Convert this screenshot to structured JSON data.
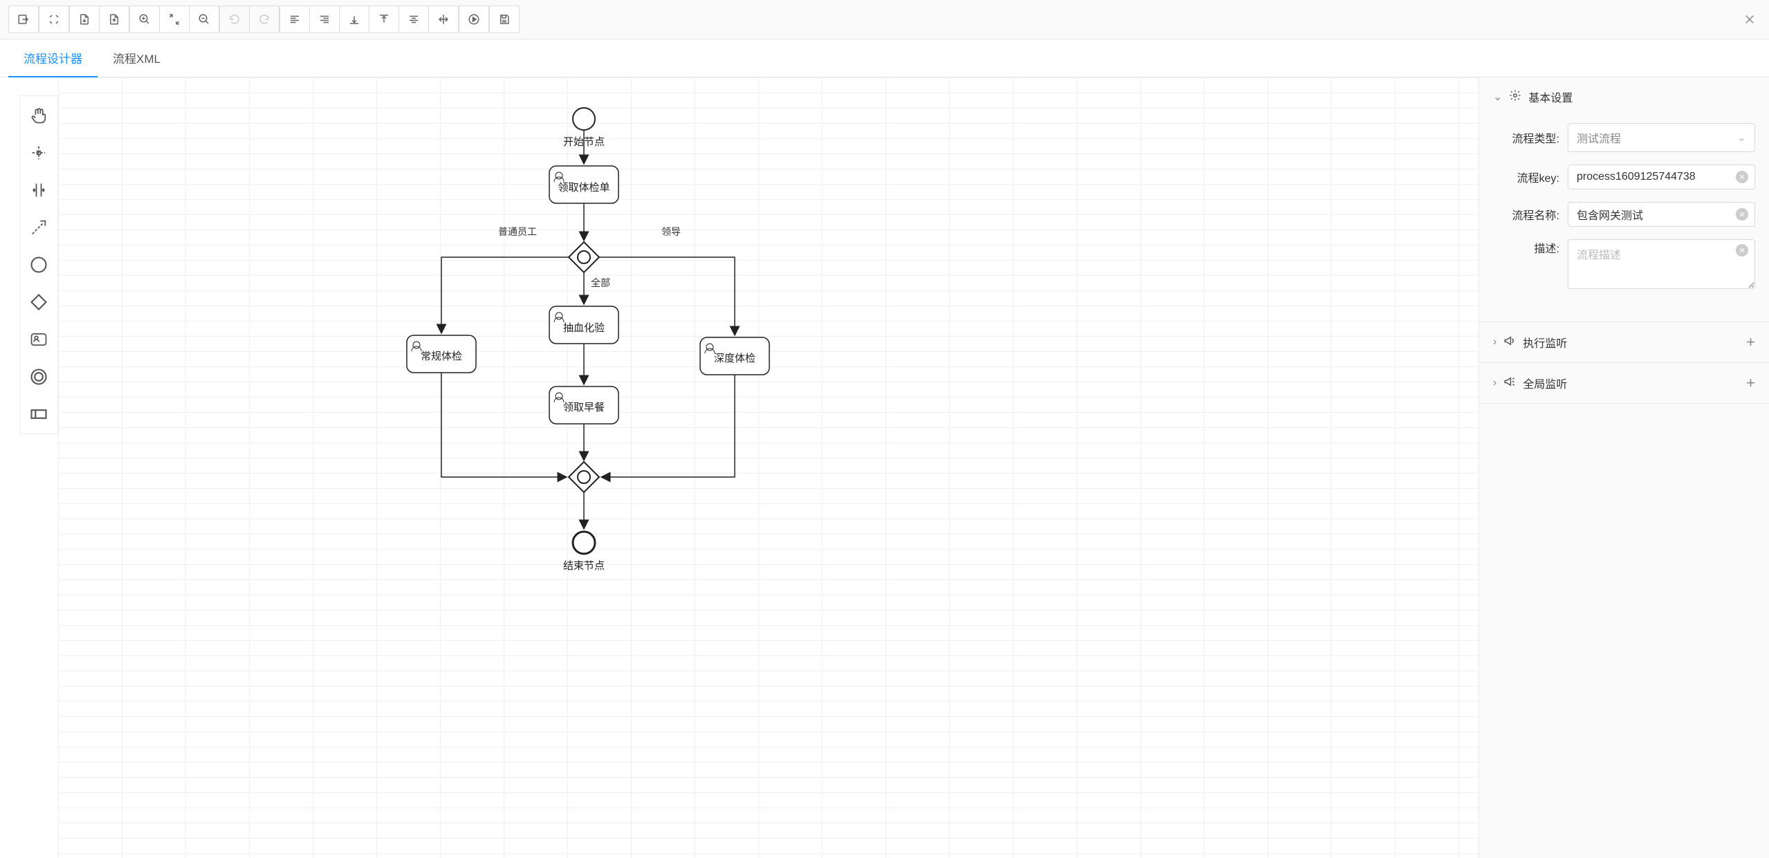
{
  "tabs": {
    "designer": "流程设计器",
    "xml": "流程XML"
  },
  "nodes": {
    "start": "开始节点",
    "end": "结束节点",
    "task_form": "领取体检单",
    "task_blood": "抽血化验",
    "task_regular": "常规体检",
    "task_deep": "深度体检",
    "task_breakfast": "领取早餐"
  },
  "edges": {
    "staff": "普通员工",
    "leader": "领导",
    "all": "全部"
  },
  "panels": {
    "basic": "基本设置",
    "exec_listener": "执行监听",
    "global_listener": "全局监听"
  },
  "form": {
    "type_label": "流程类型:",
    "type_value": "测试流程",
    "key_label": "流程key:",
    "key_value": "process1609125744738",
    "name_label": "流程名称:",
    "name_value": "包含网关测试",
    "desc_label": "描述:",
    "desc_placeholder": "流程描述"
  }
}
